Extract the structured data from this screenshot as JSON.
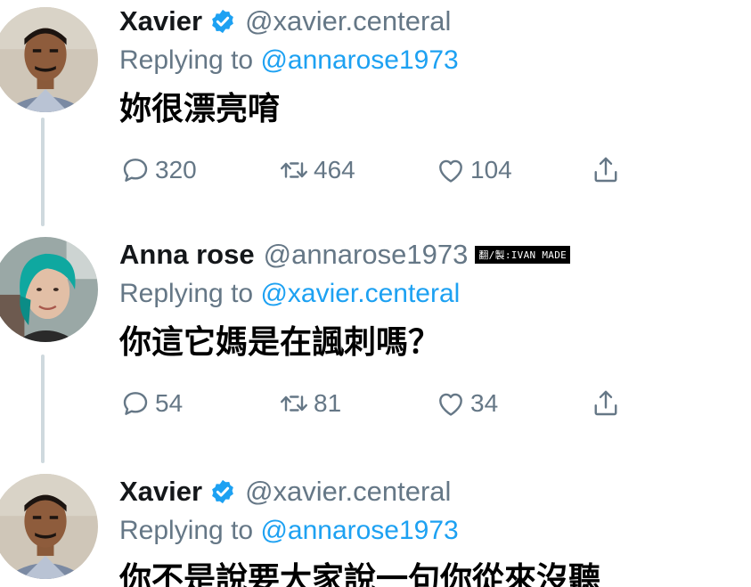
{
  "tweets": [
    {
      "author_name": "Xavier",
      "verified": true,
      "handle": "@xavier.centeral",
      "reply_prefix": "Replying to ",
      "reply_to": "@annarose1973",
      "text": "妳很漂亮唷",
      "counts": {
        "replies": "320",
        "retweets": "464",
        "likes": "104"
      }
    },
    {
      "author_name": "Anna rose",
      "verified": false,
      "handle": "@annarose1973",
      "watermark": "翻/製:IVAN MADE",
      "reply_prefix": "Replying to ",
      "reply_to": "@xavier.centeral",
      "text": "你這它媽是在諷刺嗎？",
      "counts": {
        "replies": "54",
        "retweets": "81",
        "likes": "34"
      }
    },
    {
      "author_name": "Xavier",
      "verified": true,
      "handle": "@xavier.centeral",
      "reply_prefix": "Replying to ",
      "reply_to": "@annarose1973",
      "text": "你不是說要大家說一句你從來沒聽"
    }
  ],
  "colors": {
    "accent": "#1da1f2",
    "muted": "#657786",
    "thread_line": "#cfd9de"
  },
  "icons": [
    "reply-icon",
    "retweet-icon",
    "like-icon",
    "share-icon",
    "verified-badge-icon"
  ]
}
